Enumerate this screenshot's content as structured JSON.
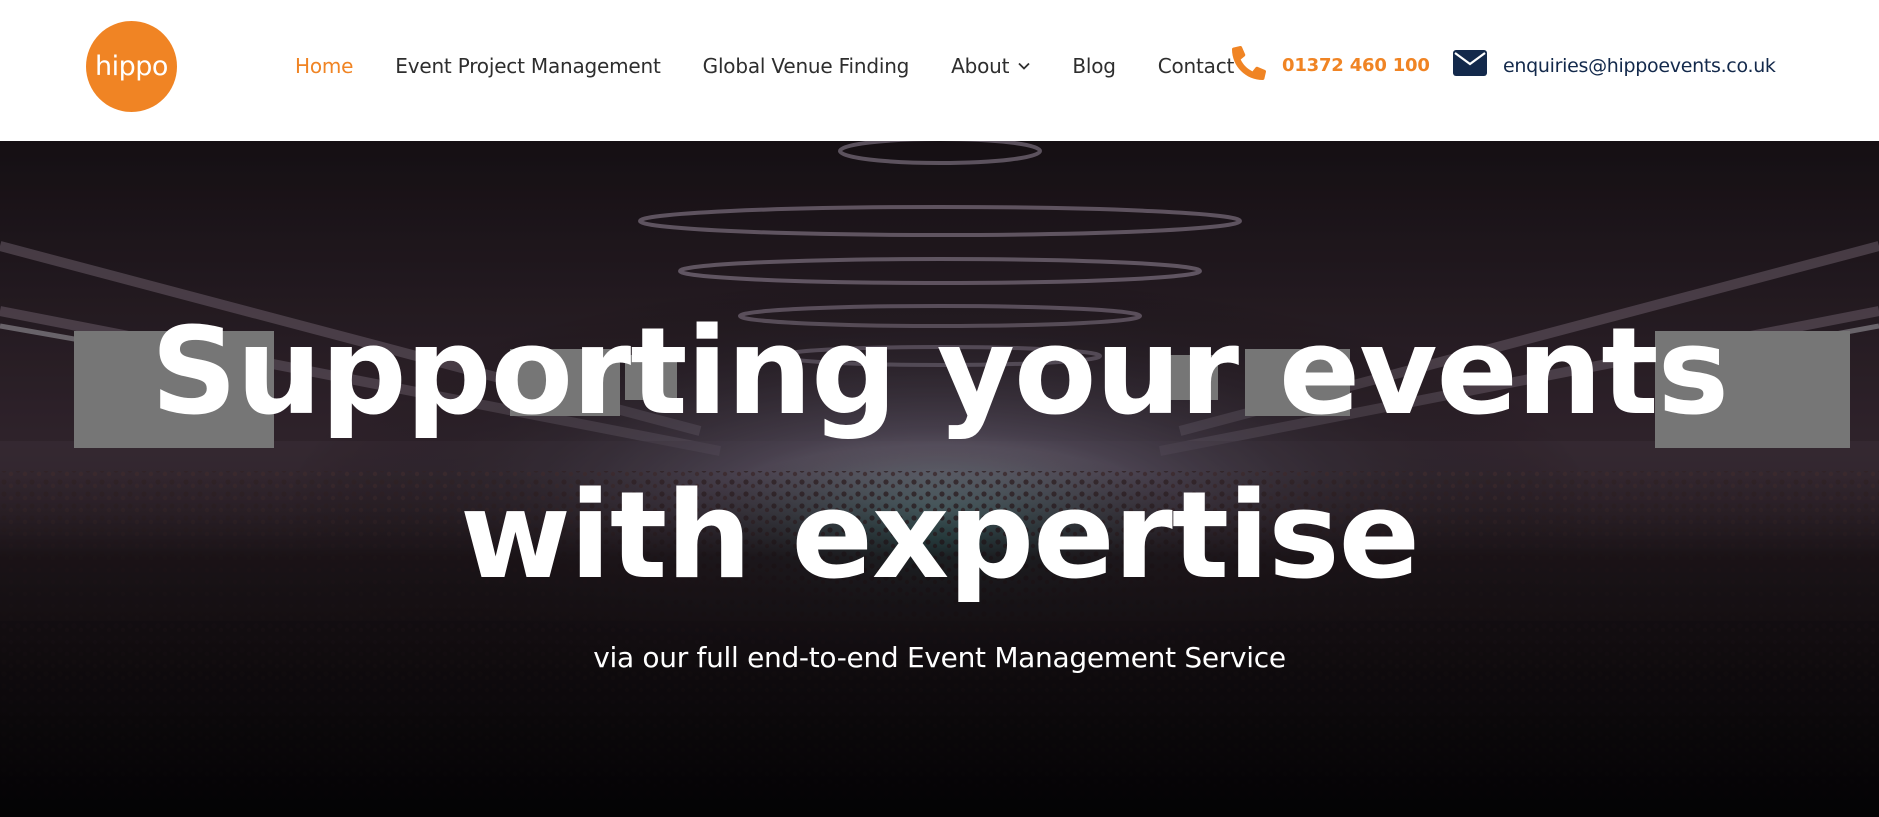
{
  "header": {
    "logo_text": "hippo",
    "nav": [
      {
        "label": "Home",
        "active": true
      },
      {
        "label": "Event Project Management",
        "active": false
      },
      {
        "label": "Global Venue Finding",
        "active": false
      },
      {
        "label": "About",
        "active": false,
        "has_dropdown": true
      },
      {
        "label": "Blog",
        "active": false
      },
      {
        "label": "Contact",
        "active": false
      }
    ],
    "phone": {
      "icon": "phone-icon",
      "text": "01372 460 100"
    },
    "email": {
      "icon": "envelope-icon",
      "text": "enquiries@hippoevents.co.uk"
    }
  },
  "hero": {
    "title_line1": "Supporting your events",
    "title_line2": "with expertise",
    "subtitle": "via our full end-to-end Event Management Service"
  },
  "colors": {
    "brand_orange": "#f08424",
    "navy": "#13294b",
    "nav_text": "#2e2e2e",
    "header_bg": "#ffffff"
  }
}
